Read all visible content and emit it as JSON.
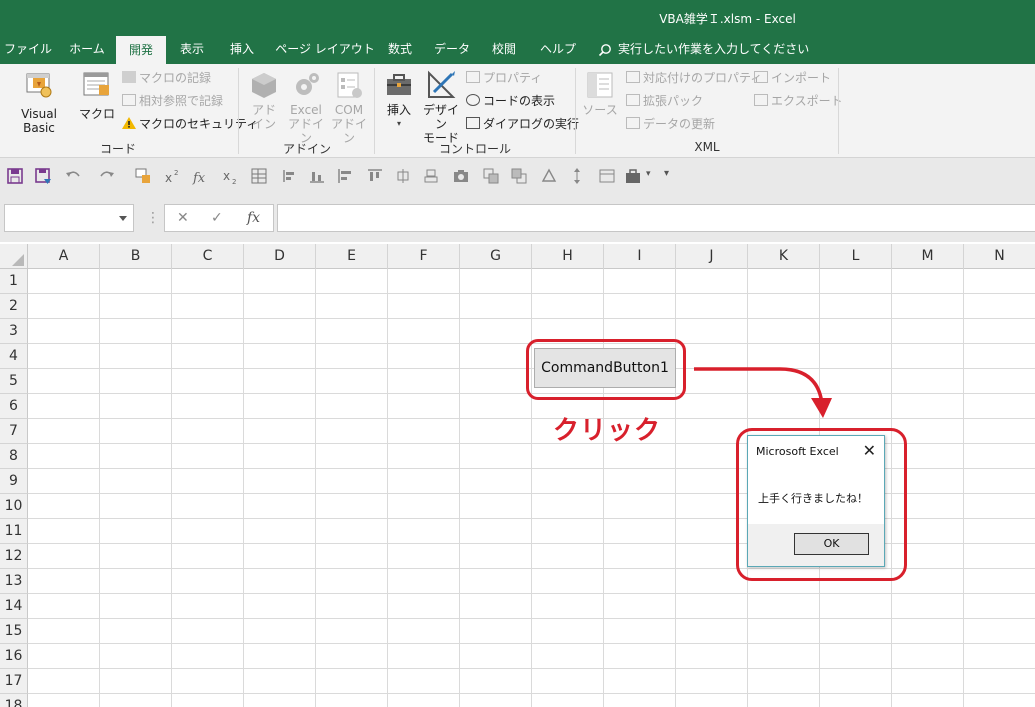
{
  "window": {
    "title": "VBA雑学Ｉ.xlsm  -  Excel"
  },
  "tabs": [
    {
      "label": "ファイル"
    },
    {
      "label": "ホーム"
    },
    {
      "label": "開発"
    },
    {
      "label": "表示"
    },
    {
      "label": "挿入"
    },
    {
      "label": "ページ レイアウト"
    },
    {
      "label": "数式"
    },
    {
      "label": "データ"
    },
    {
      "label": "校閲"
    },
    {
      "label": "ヘルプ"
    }
  ],
  "tell_me": "実行したい作業を入力してください",
  "ribbon": {
    "code": {
      "label": "コード",
      "visual_basic": "Visual Basic",
      "macro": "マクロ",
      "record_macro": "マクロの記録",
      "relative_ref": "相対参照で記録",
      "macro_security": "マクロのセキュリティ"
    },
    "addins": {
      "label": "アドイン",
      "addin_1": "アド",
      "addin_2": "イン",
      "excel_addin_1": "Excel",
      "excel_addin_2": "アドイン",
      "com_addin_1": "COM",
      "com_addin_2": "アドイン"
    },
    "controls": {
      "label": "コントロール",
      "insert": "挿入",
      "design_mode_1": "デザイン",
      "design_mode_2": "モード",
      "properties": "プロパティ",
      "view_code": "コードの表示",
      "run_dialog": "ダイアログの実行"
    },
    "xml": {
      "label": "XML",
      "source": "ソース",
      "map_properties": "対応付けのプロパティ",
      "expansion_packs": "拡張パック",
      "refresh_data": "データの更新",
      "import": "インポート",
      "export": "エクスポート"
    }
  },
  "formula_bar": {
    "name_box": "",
    "cancel": "✕",
    "enter": "✓",
    "fx": "fx",
    "value": ""
  },
  "columns": [
    "A",
    "B",
    "C",
    "D",
    "E",
    "F",
    "G",
    "H",
    "I",
    "J",
    "K",
    "L",
    "M",
    "N"
  ],
  "rows": [
    "1",
    "2",
    "3",
    "4",
    "5",
    "6",
    "7",
    "8",
    "9",
    "10",
    "11",
    "12",
    "13",
    "14",
    "15",
    "16",
    "17",
    "18"
  ],
  "command_button": {
    "label": "CommandButton1"
  },
  "annotation": {
    "text": "クリック",
    "color": "#d8202c"
  },
  "message_box": {
    "title": "Microsoft Excel",
    "message": "上手く行きましたね！",
    "ok": "OK"
  },
  "colors": {
    "excel_green": "#217346",
    "annotation_red": "#d8202c"
  }
}
